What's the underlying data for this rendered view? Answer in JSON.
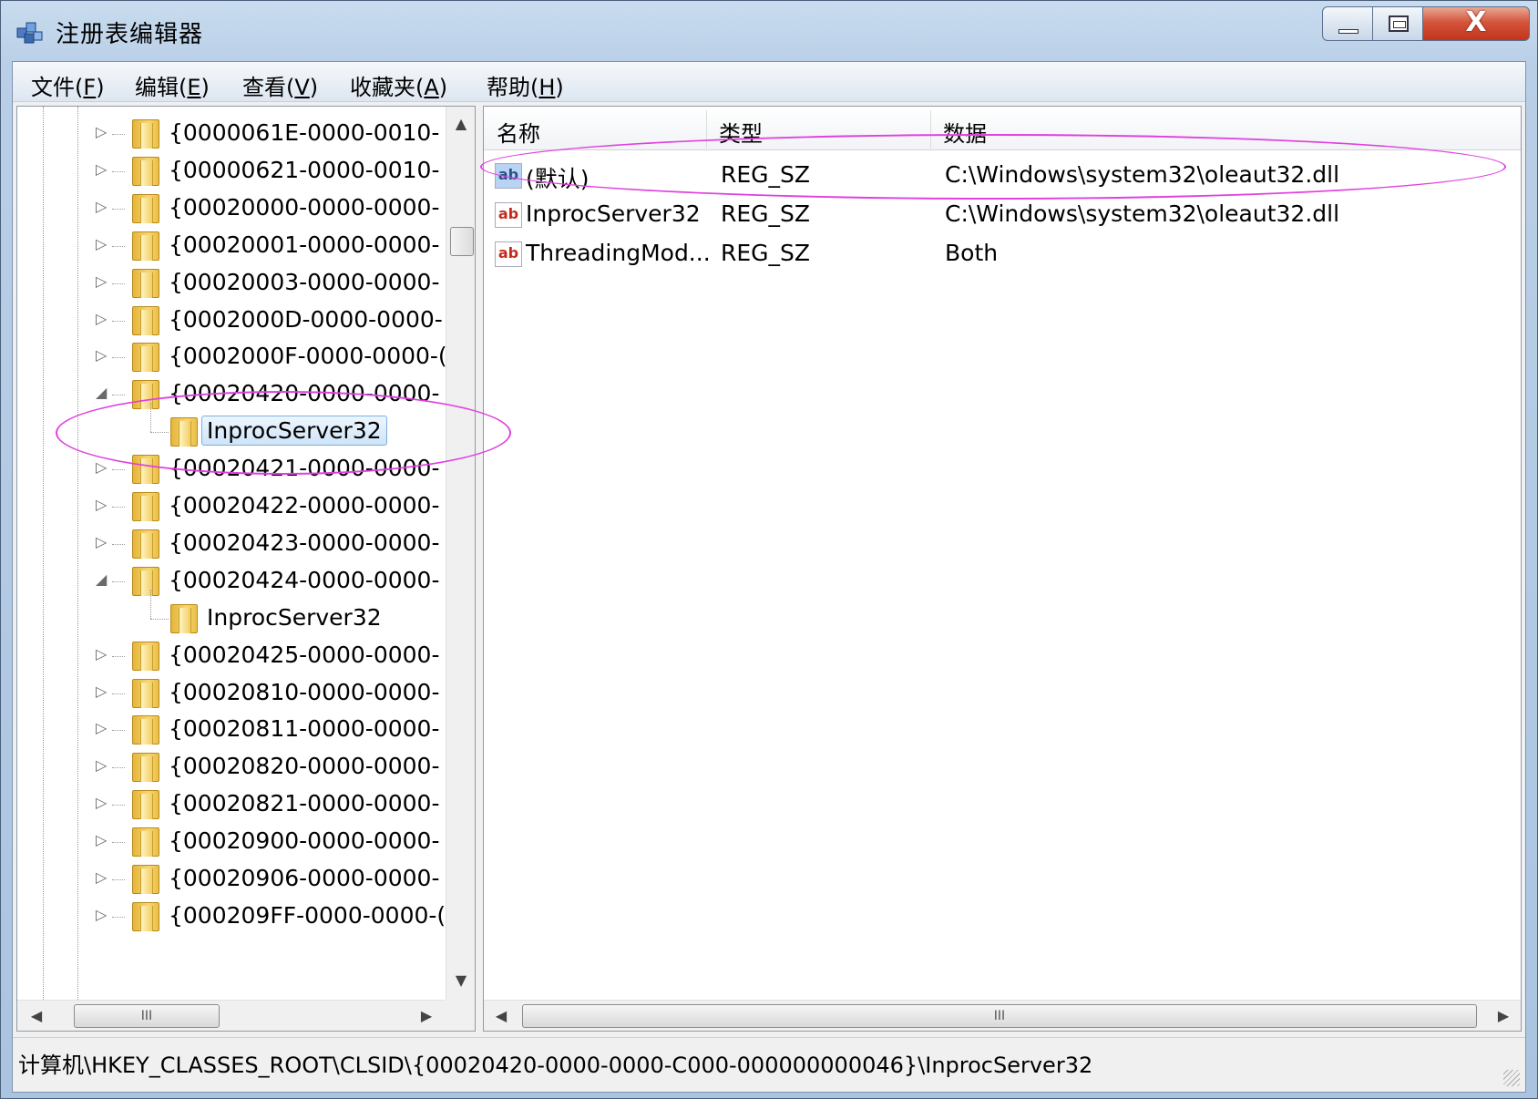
{
  "window": {
    "title": "注册表编辑器",
    "close_glyph": "X"
  },
  "menu": [
    {
      "label": "文件(",
      "accel": "F",
      "end": ")"
    },
    {
      "label": "编辑(",
      "accel": "E",
      "end": ")"
    },
    {
      "label": "查看(",
      "accel": "V",
      "end": ")"
    },
    {
      "label": "收藏夹(",
      "accel": "A",
      "end": ")"
    },
    {
      "label": "帮助(",
      "accel": "H",
      "end": ")"
    }
  ],
  "tree": {
    "items": [
      {
        "label": "{0000061E-0000-0010-",
        "state": "collapsed"
      },
      {
        "label": "{00000621-0000-0010-",
        "state": "collapsed"
      },
      {
        "label": "{00020000-0000-0000-",
        "state": "collapsed"
      },
      {
        "label": "{00020001-0000-0000-",
        "state": "collapsed"
      },
      {
        "label": "{00020003-0000-0000-",
        "state": "collapsed"
      },
      {
        "label": "{0002000D-0000-0000-",
        "state": "collapsed"
      },
      {
        "label": "{0002000F-0000-0000-(",
        "state": "collapsed"
      },
      {
        "label": "{00020420-0000-0000-",
        "state": "expanded"
      },
      {
        "label": "InprocServer32",
        "state": "child-selected"
      },
      {
        "label": "{00020421-0000-0000-",
        "state": "collapsed"
      },
      {
        "label": "{00020422-0000-0000-",
        "state": "collapsed"
      },
      {
        "label": "{00020423-0000-0000-",
        "state": "collapsed"
      },
      {
        "label": "{00020424-0000-0000-",
        "state": "expanded"
      },
      {
        "label": "InprocServer32",
        "state": "child"
      },
      {
        "label": "{00020425-0000-0000-",
        "state": "collapsed"
      },
      {
        "label": "{00020810-0000-0000-",
        "state": "collapsed"
      },
      {
        "label": "{00020811-0000-0000-",
        "state": "collapsed"
      },
      {
        "label": "{00020820-0000-0000-",
        "state": "collapsed"
      },
      {
        "label": "{00020821-0000-0000-",
        "state": "collapsed"
      },
      {
        "label": "{00020900-0000-0000-",
        "state": "collapsed"
      },
      {
        "label": "{00020906-0000-0000-",
        "state": "collapsed"
      },
      {
        "label": "{000209FF-0000-0000-(",
        "state": "collapsed"
      }
    ],
    "expander_collapsed": "▷",
    "expander_expanded": "◢",
    "scroll_up": "▲",
    "scroll_down": "▼",
    "hscroll_left": "◀",
    "hscroll_right": "▶",
    "hscroll_grip": "III"
  },
  "list": {
    "columns": [
      "名称",
      "类型",
      "数据"
    ],
    "rows": [
      {
        "icon": "ab",
        "name": "(默认)",
        "type": "REG_SZ",
        "data": "C:\\Windows\\system32\\oleaut32.dll",
        "default": true
      },
      {
        "icon": "ab",
        "name": "InprocServer32",
        "type": "REG_SZ",
        "data": "C:\\Windows\\system32\\oleaut32.dll",
        "default": false
      },
      {
        "icon": "ab",
        "name": "ThreadingMod...",
        "type": "REG_SZ",
        "data": "Both",
        "default": false
      }
    ],
    "hscroll_left": "◀",
    "hscroll_right": "▶",
    "hscroll_grip": "III"
  },
  "status": {
    "path": "计算机\\HKEY_CLASSES_ROOT\\CLSID\\{00020420-0000-0000-C000-000000000046}\\InprocServer32"
  },
  "colors": {
    "annotation": "#e040e0",
    "close_button": "#c2341e",
    "selection": "#cfe4f8"
  }
}
